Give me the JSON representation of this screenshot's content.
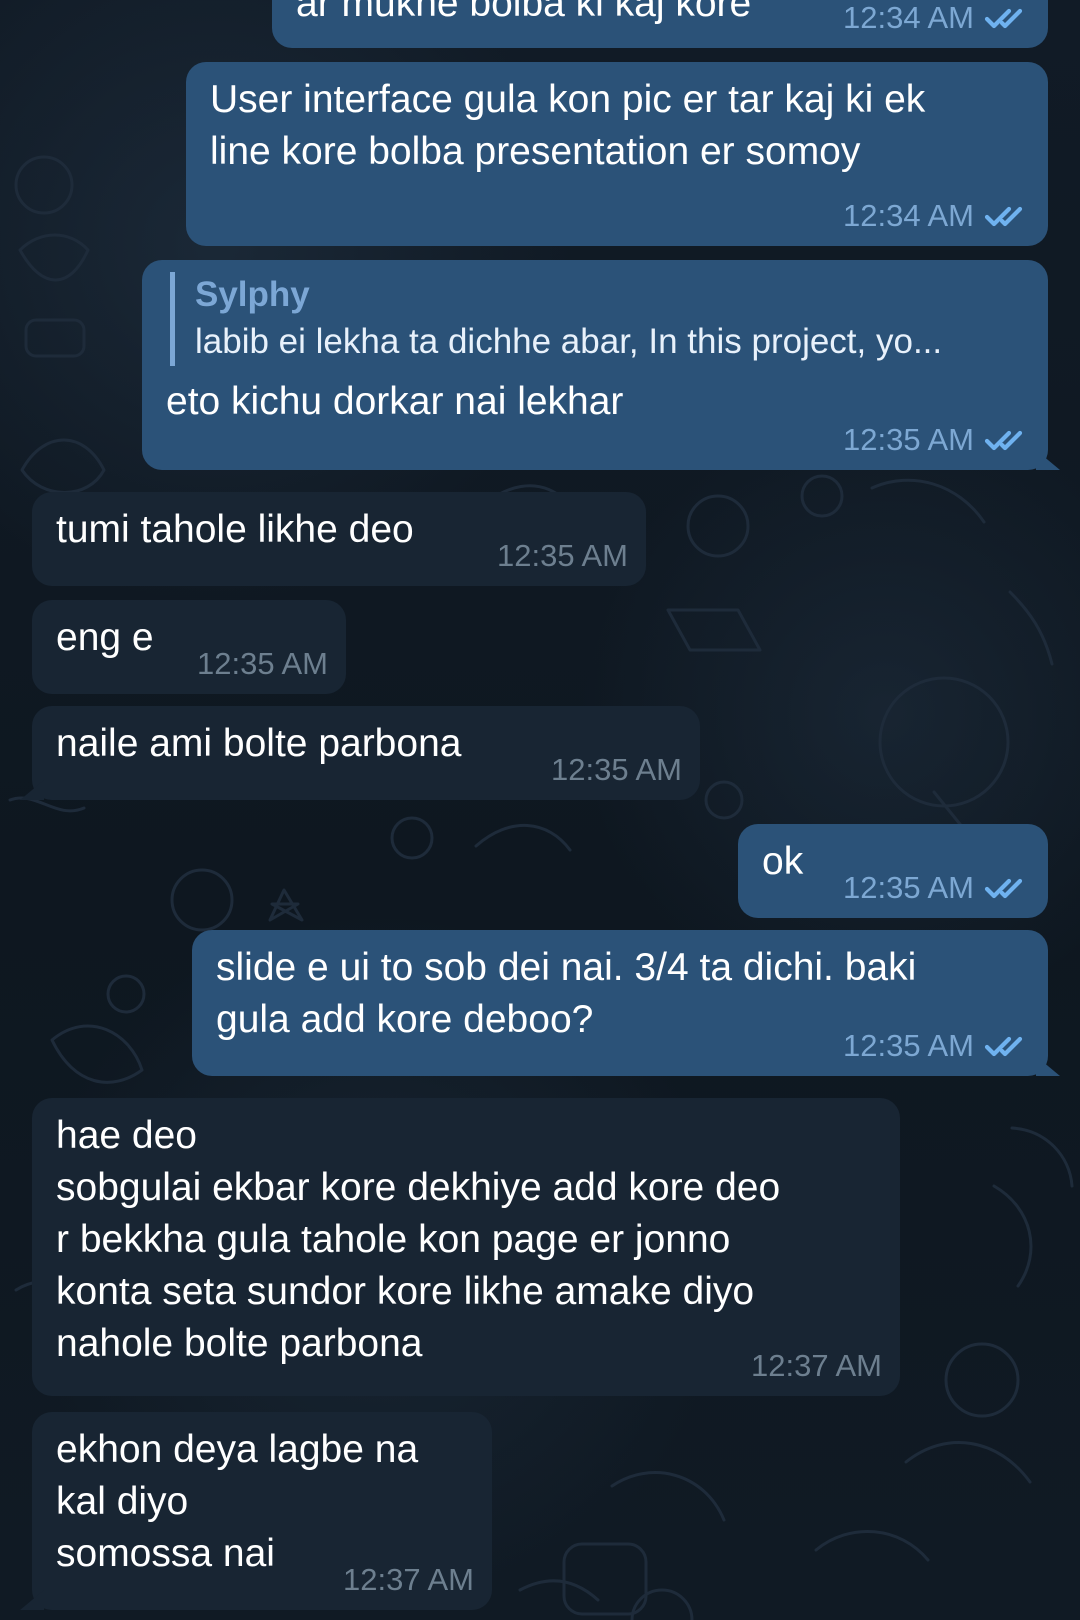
{
  "messages": [
    {
      "id": "m1",
      "dir": "out",
      "text": "ar mukhe bolba ki kaj kore",
      "time": "12:34 AM",
      "status": "read"
    },
    {
      "id": "m2",
      "dir": "out",
      "text": "User interface gula kon pic er tar kaj ki ek\nline kore bolba presentation er somoy",
      "time": "12:34 AM",
      "status": "read"
    },
    {
      "id": "m3",
      "dir": "out",
      "reply": {
        "name": "Sylphy",
        "text": "labib ei lekha ta dichhe abar,  In this project, yo..."
      },
      "text": "eto kichu dorkar nai lekhar",
      "time": "12:35 AM",
      "status": "read"
    },
    {
      "id": "m4",
      "dir": "in",
      "text": "tumi tahole likhe deo",
      "time": "12:35 AM"
    },
    {
      "id": "m5",
      "dir": "in",
      "text": "eng e",
      "time": "12:35 AM"
    },
    {
      "id": "m6",
      "dir": "in",
      "text": "naile ami bolte parbona",
      "time": "12:35 AM"
    },
    {
      "id": "m7",
      "dir": "out",
      "text": "ok",
      "time": "12:35 AM",
      "status": "read"
    },
    {
      "id": "m8",
      "dir": "out",
      "text": "slide e ui to sob dei nai. 3/4 ta dichi. baki\ngula add kore deboo?",
      "time": "12:35 AM",
      "status": "read"
    },
    {
      "id": "m9",
      "dir": "in",
      "text": "hae deo\nsobgulai ekbar kore dekhiye add kore deo\nr bekkha gula tahole kon page er jonno\nkonta seta sundor kore likhe amake diyo\nnahole bolte parbona",
      "time": "12:37 AM"
    },
    {
      "id": "m10",
      "dir": "in",
      "text": "ekhon deya lagbe na\nkal diyo\nsomossa nai",
      "time": "12:37 AM"
    }
  ],
  "icons": {
    "read_receipt": "double-check-icon"
  },
  "colors": {
    "background": "#0f1822",
    "outgoing_bubble": "#2b5278",
    "incoming_bubble": "#182533",
    "read_check": "#6fb2f0",
    "reply_accent": "#7ca7d5",
    "incoming_time": "#6d7f8f",
    "outgoing_time": "#7da8d3"
  }
}
